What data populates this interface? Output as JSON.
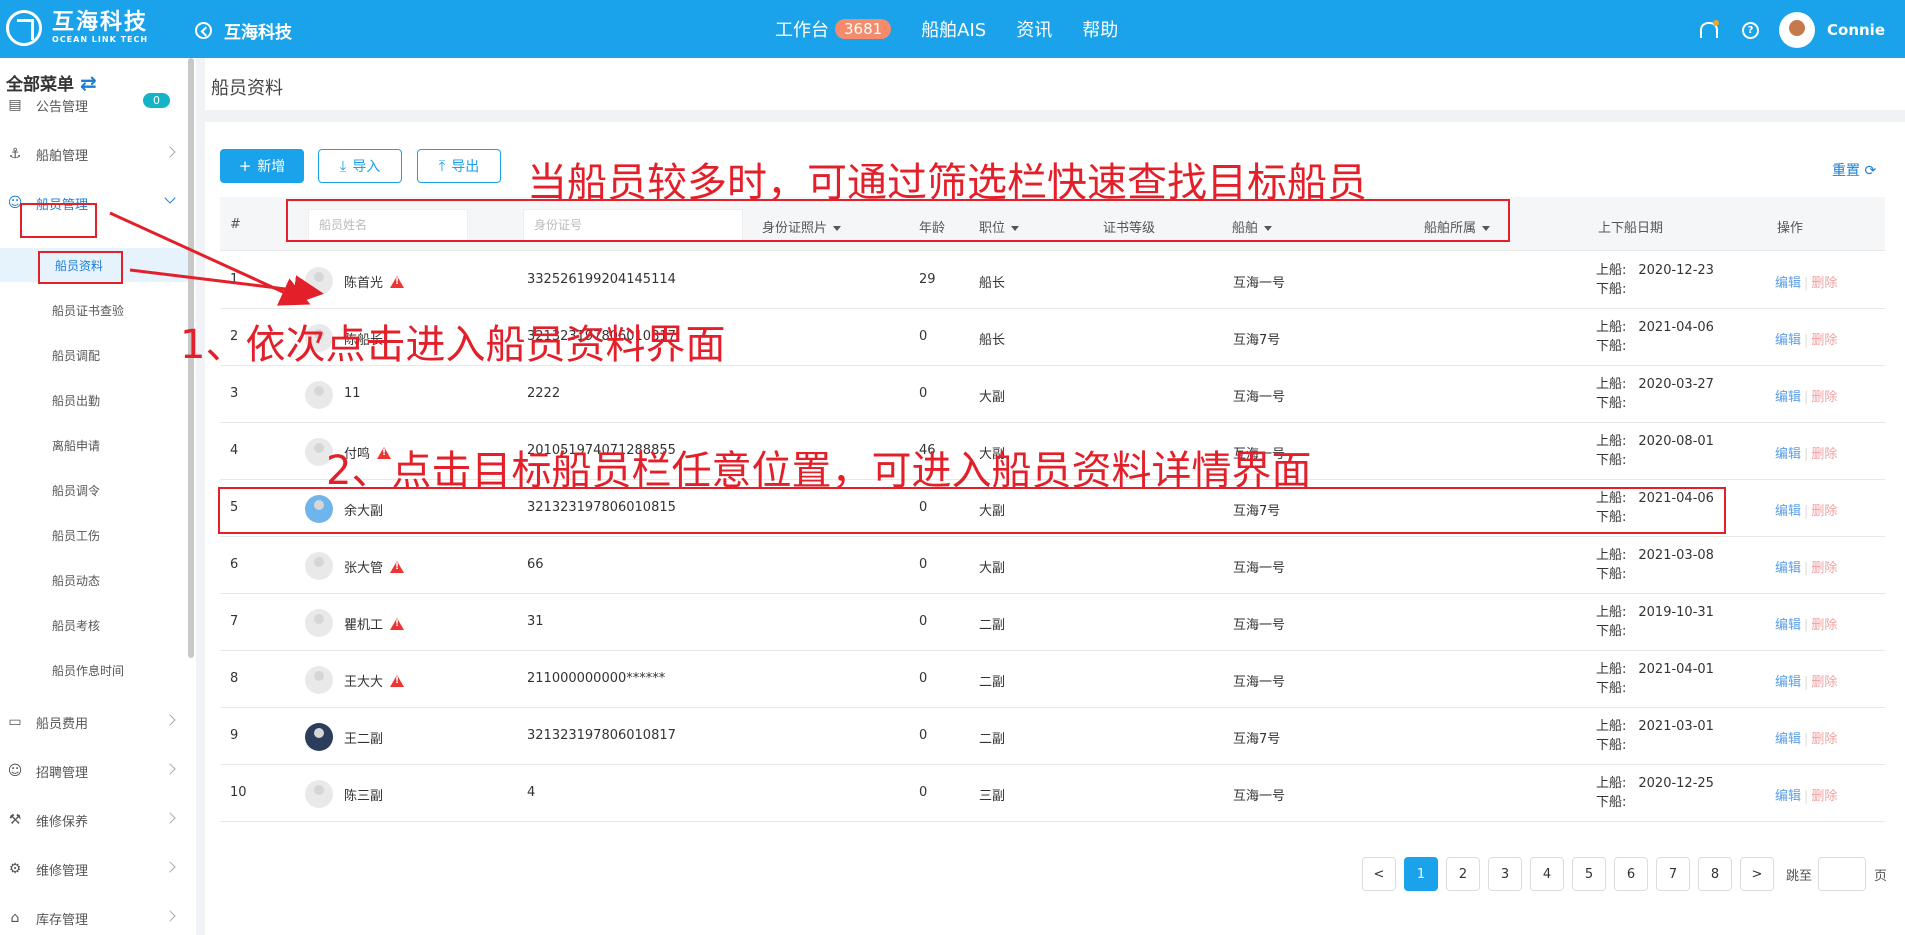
{
  "topbar": {
    "logo_title": "互海科技",
    "logo_sub": "OCEAN LINK TECH",
    "back_label": "互海科技",
    "nav": [
      {
        "label": "工作台",
        "badge": "3681"
      },
      {
        "label": "船舶AIS"
      },
      {
        "label": "资讯"
      },
      {
        "label": "帮助"
      }
    ],
    "help_glyph": "?",
    "username": "Connie"
  },
  "sidebar": {
    "header": "全部菜单",
    "notice_badge": "0",
    "items": [
      {
        "label": "公告管理",
        "icon": "book-icon"
      },
      {
        "label": "船舶管理",
        "icon": "anchor-icon"
      },
      {
        "label": "船员管理",
        "icon": "user-icon"
      },
      {
        "label": "船员费用",
        "icon": "wallet-icon"
      },
      {
        "label": "招聘管理",
        "icon": "user-add-icon"
      },
      {
        "label": "维修保养",
        "icon": "hammer-icon"
      },
      {
        "label": "维修管理",
        "icon": "wrench-icon"
      },
      {
        "label": "库存管理",
        "icon": "home-icon"
      }
    ],
    "sub_items": [
      "船员资料",
      "船员证书查验",
      "船员调配",
      "船员出勤",
      "离船申请",
      "船员调令",
      "船员工伤",
      "船员动态",
      "船员考核",
      "船员作息时间"
    ]
  },
  "page": {
    "title": "船员资料",
    "toolbar": {
      "add": "新增",
      "import": "导入",
      "export": "导出",
      "reset": "重置"
    },
    "filters": {
      "name_placeholder": "船员姓名",
      "id_placeholder": "身份证号"
    },
    "columns": [
      "#",
      "身份证照片",
      "年龄",
      "职位",
      "证书等级",
      "船舶",
      "船舶所属",
      "上下船日期",
      "操作"
    ],
    "labels": {
      "on": "上船:",
      "off": "下船:",
      "edit": "编辑",
      "delete": "删除"
    },
    "rows": [
      {
        "no": "1",
        "name": "陈首光",
        "warn": true,
        "id": "332526199204145114",
        "age": "29",
        "pos": "船长",
        "ship": "互海一号",
        "on": "2020-12-23",
        "avatar": "default"
      },
      {
        "no": "2",
        "name": "陈船长",
        "warn": false,
        "id": "321323197806010817",
        "age": "0",
        "pos": "船长",
        "ship": "互海7号",
        "on": "2021-04-06",
        "avatar": "default"
      },
      {
        "no": "3",
        "name": "11",
        "warn": false,
        "id": "2222",
        "age": "0",
        "pos": "大副",
        "ship": "互海一号",
        "on": "2020-03-27",
        "avatar": "default"
      },
      {
        "no": "4",
        "name": "付鸣",
        "warn": true,
        "id": "201051974071288855",
        "age": "46",
        "pos": "大副",
        "ship": "互海一号",
        "on": "2020-08-01",
        "avatar": "default"
      },
      {
        "no": "5",
        "name": "余大副",
        "warn": false,
        "id": "321323197806010815",
        "age": "0",
        "pos": "大副",
        "ship": "互海7号",
        "on": "2021-04-06",
        "avatar": "blue"
      },
      {
        "no": "6",
        "name": "张大管",
        "warn": true,
        "id": "66",
        "age": "0",
        "pos": "大副",
        "ship": "互海一号",
        "on": "2021-03-08",
        "avatar": "default"
      },
      {
        "no": "7",
        "name": "瞿机工",
        "warn": true,
        "id": "31",
        "age": "0",
        "pos": "二副",
        "ship": "互海一号",
        "on": "2019-10-31",
        "avatar": "default"
      },
      {
        "no": "8",
        "name": "王大大",
        "warn": true,
        "id": "211000000000******",
        "age": "0",
        "pos": "二副",
        "ship": "互海一号",
        "on": "2021-04-01",
        "avatar": "default"
      },
      {
        "no": "9",
        "name": "王二副",
        "warn": false,
        "id": "321323197806010817",
        "age": "0",
        "pos": "二副",
        "ship": "互海7号",
        "on": "2021-03-01",
        "avatar": "dark"
      },
      {
        "no": "10",
        "name": "陈三副",
        "warn": false,
        "id": "4",
        "age": "0",
        "pos": "三副",
        "ship": "互海一号",
        "on": "2020-12-25",
        "avatar": "default"
      }
    ],
    "pagination": {
      "prev": "<",
      "next": ">",
      "pages": [
        "1",
        "2",
        "3",
        "4",
        "5",
        "6",
        "7",
        "8"
      ],
      "current": "1",
      "jump_label": "跳至",
      "page_suffix": "页"
    }
  },
  "annotations": {
    "filter_hint": "当船员较多时，可通过筛选栏快速查找目标船员",
    "step1": "1、依次点击进入船员资料界面",
    "step2": "2、点击目标船员栏任意位置，可进入船员资料详情界面"
  },
  "colors": {
    "topbar": "#1aa3ea",
    "accent": "#1a7fd4",
    "annotation": "#e3202a",
    "warning": "#e33"
  }
}
